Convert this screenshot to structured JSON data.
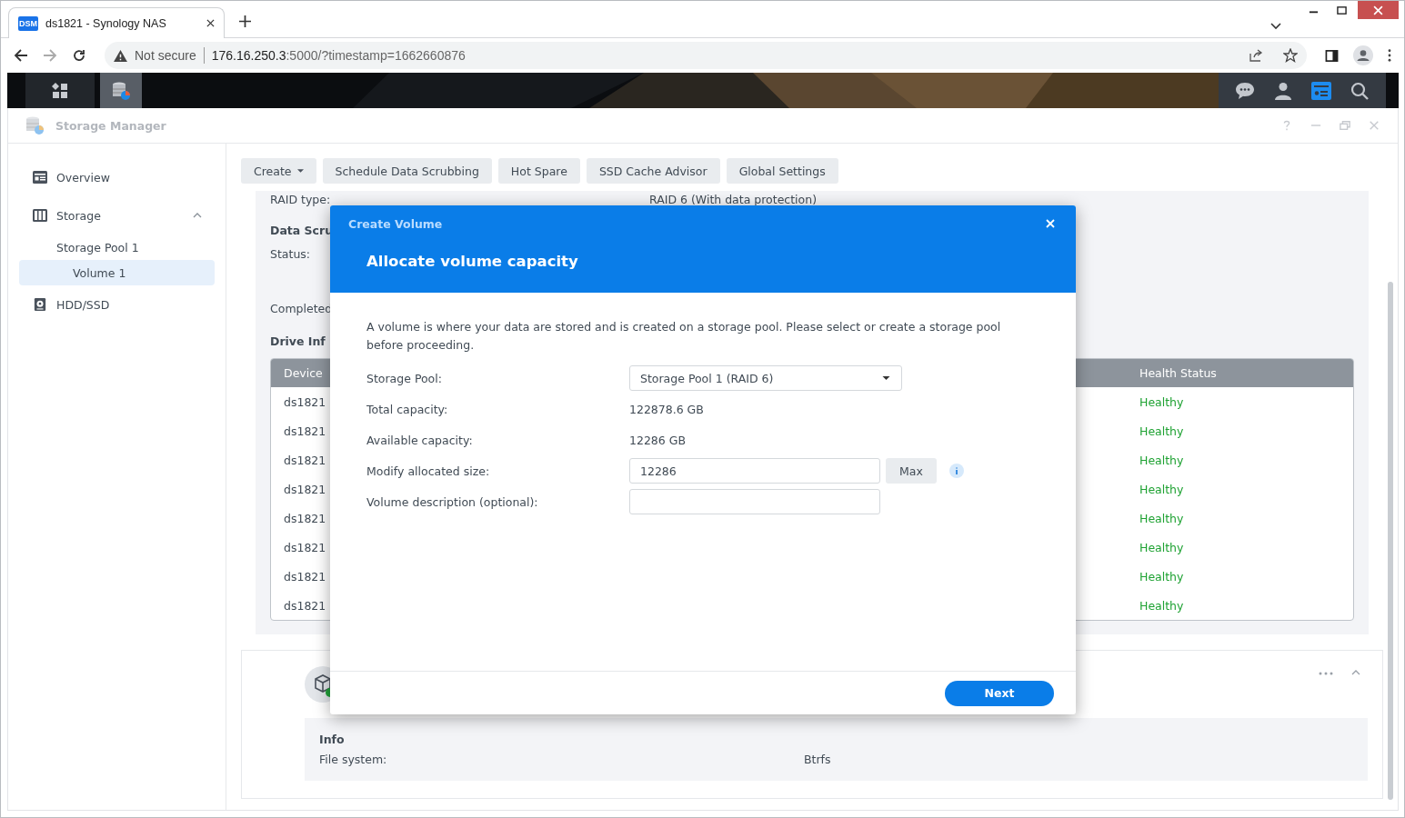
{
  "browser": {
    "tab": {
      "favicon": "DSM",
      "title": "ds1821 - Synology NAS"
    },
    "address": {
      "security": "Not secure",
      "host": "176.16.250.3",
      "rest": ":5000/?timestamp=1662660876"
    }
  },
  "app": {
    "title": "Storage Manager"
  },
  "sidebar": {
    "items": [
      {
        "label": "Overview",
        "kind": "overview",
        "selected": false
      },
      {
        "label": "Storage",
        "kind": "storage",
        "selected": false,
        "expanded": true,
        "children": [
          {
            "label": "Storage Pool 1",
            "selected": false,
            "children": [
              {
                "label": "Volume 1",
                "selected": true
              }
            ]
          }
        ]
      },
      {
        "label": "HDD/SSD",
        "kind": "disk",
        "selected": false
      }
    ]
  },
  "toolbar": [
    {
      "label": "Create",
      "dropdown": true
    },
    {
      "label": "Schedule Data Scrubbing",
      "dropdown": false
    },
    {
      "label": "Hot Spare",
      "dropdown": false
    },
    {
      "label": "SSD Cache Advisor",
      "dropdown": false
    },
    {
      "label": "Global Settings",
      "dropdown": false
    }
  ],
  "details": {
    "raid_label": "RAID type:",
    "raid_value": "RAID 6 (With data protection)",
    "scrub_heading": "Data Scru",
    "status_label": "Status:",
    "completed_label": "Completed",
    "drive_heading": "Drive Inf"
  },
  "table": {
    "columns": [
      {
        "label": "Device"
      },
      {
        "label": "Health Status"
      }
    ],
    "rows": [
      {
        "device": "ds1821",
        "health": "Healthy"
      },
      {
        "device": "ds1821",
        "health": "Healthy"
      },
      {
        "device": "ds1821",
        "health": "Healthy"
      },
      {
        "device": "ds1821",
        "health": "Healthy"
      },
      {
        "device": "ds1821",
        "health": "Healthy"
      },
      {
        "device": "ds1821",
        "health": "Healthy"
      },
      {
        "device": "ds1821",
        "health": "Healthy"
      },
      {
        "device": "ds1821",
        "health": "Healthy"
      }
    ]
  },
  "volume": {
    "info_title": "Info",
    "fields": [
      {
        "label": "File system:",
        "value": "Btrfs"
      }
    ]
  },
  "dialog": {
    "title": "Create Volume",
    "heading": "Allocate volume capacity",
    "intro": "A volume is where your data are stored and is created on a storage pool. Please select or create a storage pool before proceeding.",
    "fields": [
      {
        "kind": "select",
        "label": "Storage Pool:",
        "value": "Storage Pool 1 (RAID 6)"
      },
      {
        "kind": "text",
        "label": "Total capacity:",
        "value": "122878.6 GB"
      },
      {
        "kind": "text",
        "label": "Available capacity:",
        "value": "12286 GB"
      },
      {
        "kind": "input",
        "label": "Modify allocated size:",
        "value": "12286",
        "button": "Max",
        "info": true
      },
      {
        "kind": "input",
        "label": "Volume description (optional):"
      }
    ],
    "next": "Next"
  }
}
